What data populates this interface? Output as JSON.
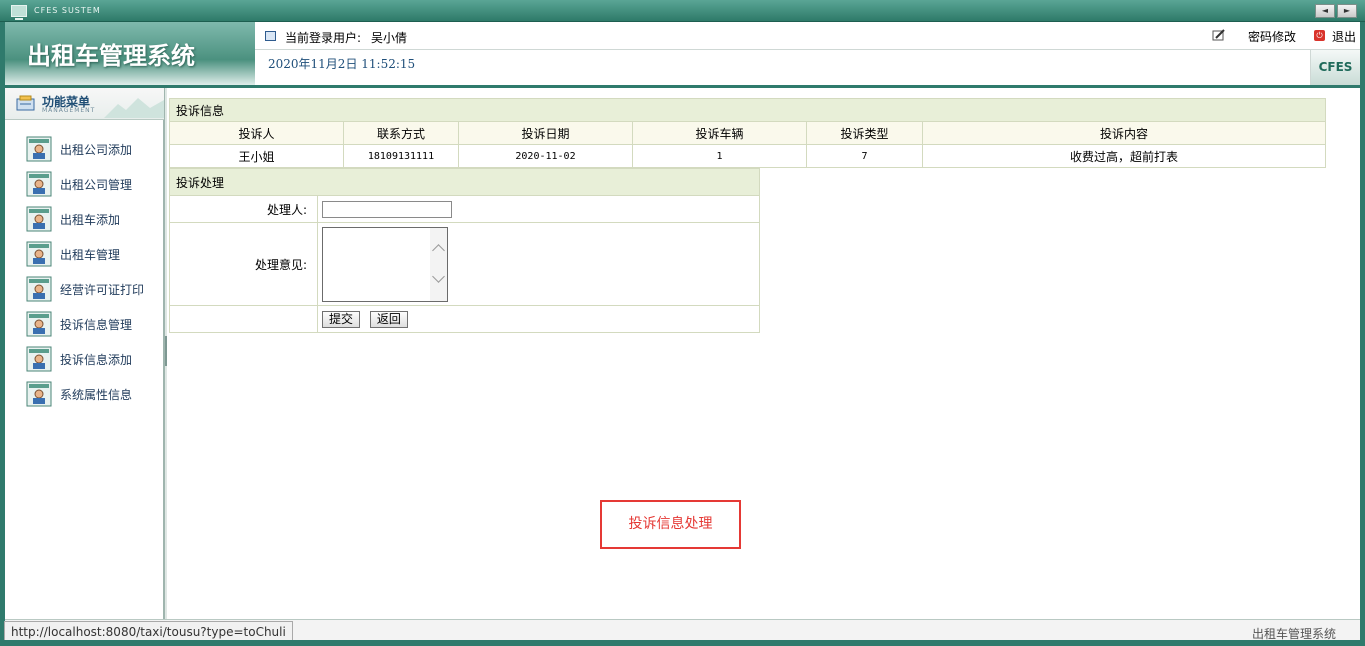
{
  "titlebar": {
    "system_label": "CFES SUSTEM",
    "nav_prev": "◄",
    "nav_next": "►"
  },
  "header": {
    "app_title": "出租车管理系统",
    "current_user_label": "当前登录用户:",
    "current_user_name": "吴小倩",
    "datetime": "2020年11月2日 11:52:15",
    "change_password": "密码修改",
    "logout": "退出",
    "badge": "CFES"
  },
  "sidebar": {
    "title": "功能菜单",
    "subtitle": "MANAGEMENT",
    "items": [
      {
        "label": "出租公司添加"
      },
      {
        "label": "出租公司管理"
      },
      {
        "label": "出租车添加"
      },
      {
        "label": "出租车管理"
      },
      {
        "label": "经营许可证打印"
      },
      {
        "label": "投诉信息管理"
      },
      {
        "label": "投诉信息添加"
      },
      {
        "label": "系统属性信息"
      }
    ]
  },
  "complaint_info": {
    "section_title": "投诉信息",
    "columns": [
      "投诉人",
      "联系方式",
      "投诉日期",
      "投诉车辆",
      "投诉类型",
      "投诉内容"
    ],
    "rows": [
      [
        "王小姐",
        "18109131111",
        "2020-11-02",
        "1",
        "7",
        "收费过高，超前打表"
      ]
    ]
  },
  "complaint_process": {
    "section_title": "投诉处理",
    "handler_label": "处理人:",
    "handler_value": "",
    "opinion_label": "处理意见:",
    "opinion_value": "",
    "submit_label": "提交",
    "back_label": "返回"
  },
  "annotation": "投诉信息处理",
  "footer": {
    "status_url": "http://localhost:8080/taxi/tousu?type=toChuli",
    "credit": "出租车管理系统"
  },
  "colors": {
    "brand": "#2f7a6c",
    "highlight": "#e53935",
    "section_bg": "#e8efd8"
  }
}
